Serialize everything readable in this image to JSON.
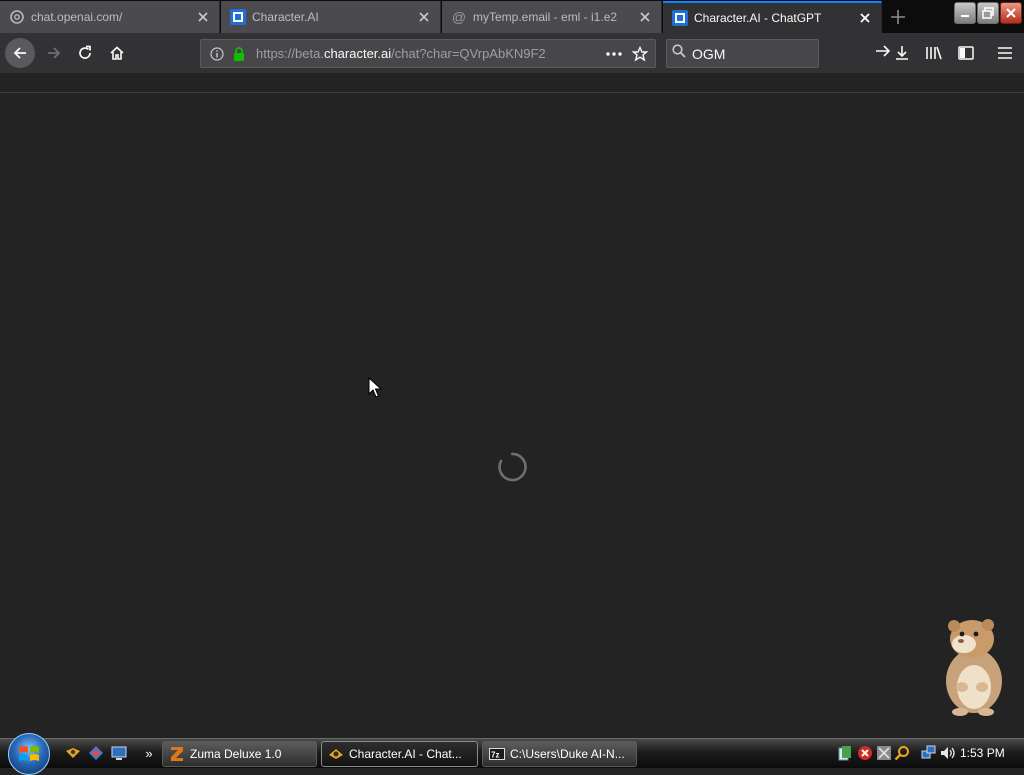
{
  "browser": {
    "tabs": [
      {
        "title": "chat.openai.com/",
        "favicon": "openai-icon",
        "active": false
      },
      {
        "title": "Character.AI",
        "favicon": "character-ai-icon",
        "active": false
      },
      {
        "title": "myTemp.email - eml - i1.e2",
        "favicon": "at-sign-icon",
        "active": false
      },
      {
        "title": "Character.AI - ChatGPT",
        "favicon": "character-ai-icon",
        "active": true
      }
    ],
    "url": {
      "prefix": "https://beta.",
      "host": "character.ai",
      "path": "/chat?char=QVrpAbKN9F2"
    },
    "search": {
      "value": "OGM"
    }
  },
  "page": {
    "state": "loading",
    "spinner_icon": "loading-spinner-icon"
  },
  "taskbar": {
    "quick_launch": [
      "media-player-icon",
      "network-icon",
      "show-desktop-icon"
    ],
    "overflow_label": "»",
    "buttons": [
      {
        "label": "Zuma Deluxe 1.0",
        "icon": "zuma-icon",
        "active": false
      },
      {
        "label": "Character.AI - Chat...",
        "icon": "firefox-icon",
        "active": true
      },
      {
        "label": "C:\\Users\\Duke AI-N...",
        "icon": "7zip-icon",
        "active": false
      }
    ],
    "tray": [
      "tray-app-icon",
      "security-alert-icon",
      "network-tray-icon",
      "search-tray-icon",
      "network-connection-icon",
      "volume-icon"
    ],
    "clock": "1:53 PM"
  },
  "colors": {
    "tab_active_accent": "#0a84ff",
    "secure_lock": "#12bc00",
    "content_bg": "#232323",
    "toolbar_bg": "#323234"
  }
}
